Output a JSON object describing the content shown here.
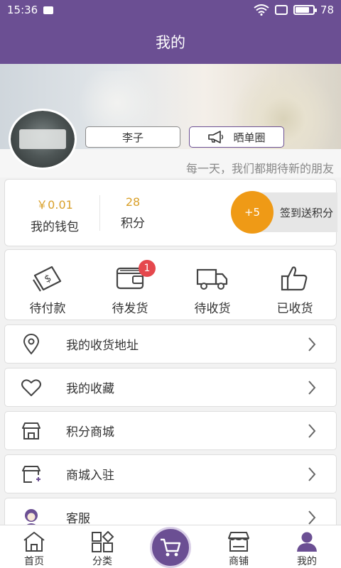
{
  "status": {
    "time": "15:36",
    "battery": "78",
    "battery_level": 0.78
  },
  "header": {
    "title": "我的"
  },
  "profile": {
    "name": "李子",
    "share_label": "晒单圈",
    "slogan": "每一天，我们都期待新的朋友"
  },
  "wallet": {
    "balance": "￥0.01",
    "balance_label": "我的钱包",
    "points": "28",
    "points_label": "积分",
    "checkin_bonus": "+5",
    "checkin_label": "签到送积分"
  },
  "orders": [
    {
      "label": "待付款",
      "icon": "payment-icon"
    },
    {
      "label": "待发货",
      "icon": "wallet-icon",
      "badge": "1"
    },
    {
      "label": "待收货",
      "icon": "truck-icon"
    },
    {
      "label": "已收货",
      "icon": "thumbs-up-icon"
    }
  ],
  "menu": [
    {
      "label": "我的收货地址",
      "icon": "location-pin-icon"
    },
    {
      "label": "我的收藏",
      "icon": "heart-icon"
    },
    {
      "label": "积分商城",
      "icon": "store-icon"
    },
    {
      "label": "商城入驻",
      "icon": "store-add-icon"
    },
    {
      "label": "客服",
      "icon": "customer-service-icon"
    }
  ],
  "nav": [
    {
      "label": "首页",
      "icon": "home-icon"
    },
    {
      "label": "分类",
      "icon": "category-icon"
    },
    {
      "label": "",
      "icon": "cart-icon"
    },
    {
      "label": "商铺",
      "icon": "shop-icon"
    },
    {
      "label": "我的",
      "icon": "user-icon"
    }
  ],
  "colors": {
    "brand": "#6b4f93",
    "accent": "#ef9a16",
    "badge": "#e5484d",
    "money": "#d9a02a"
  }
}
